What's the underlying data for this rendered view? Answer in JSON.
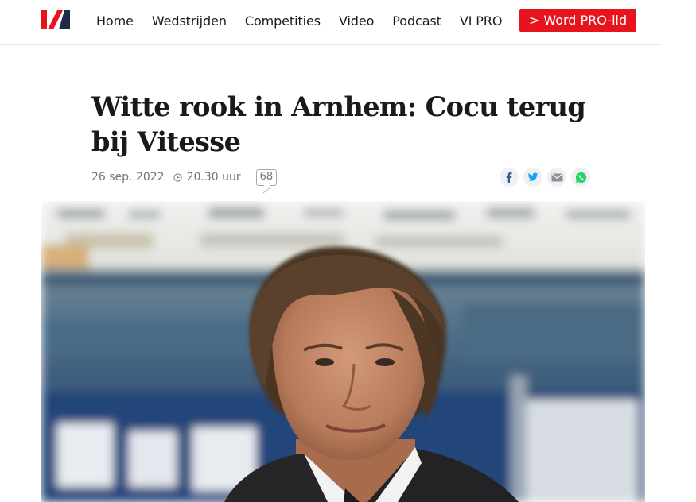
{
  "header": {
    "logo_alt": "VI",
    "nav": [
      "Home",
      "Wedstrijden",
      "Competities",
      "Video",
      "Podcast",
      "VI PRO"
    ],
    "cta_label": "> Word PRO-lid",
    "brand_color": "#e8141d"
  },
  "article": {
    "title": "Witte rook in Arnhem: Cocu terug bij Vitesse",
    "date": "26 sep. 2022",
    "time": "20.30 uur",
    "comment_count": "68"
  },
  "share": {
    "icons": [
      "facebook-icon",
      "twitter-icon",
      "email-icon",
      "whatsapp-icon"
    ]
  }
}
